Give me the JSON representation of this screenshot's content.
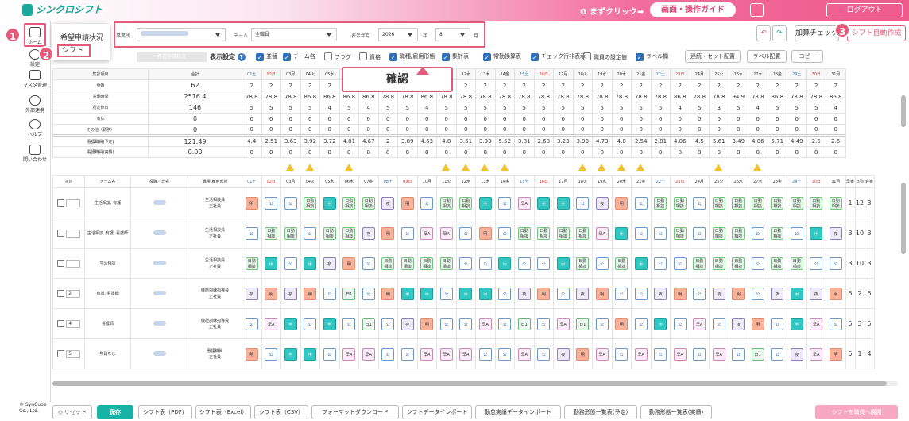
{
  "header": {
    "logo": "シンクロシフト",
    "prompt": "❶ まずクリック➡",
    "guide": "画面・操作ガイド",
    "logout": "ログアウト"
  },
  "sidebar": [
    {
      "label": "ホーム",
      "icon": "home-calendar-icon"
    },
    {
      "label": "設定",
      "icon": "gear-icon"
    },
    {
      "label": "マスタ管理",
      "icon": "database-icon"
    },
    {
      "label": "外部連携",
      "icon": "cloud-icon"
    },
    {
      "label": "ヘルプ",
      "icon": "help-icon"
    },
    {
      "label": "問い合わせ",
      "icon": "mail-icon"
    }
  ],
  "copyright": "© SynCube Co., Ltd.",
  "callouts": [
    "1",
    "2",
    "3"
  ],
  "popup": {
    "item1": "希望申請状況",
    "item2": "シフト"
  },
  "filters": {
    "office_label": "事業所",
    "team_label": "チーム",
    "team_value": "全職員",
    "ym_label": "表示年月",
    "year": "2026",
    "year_unit": "年",
    "month": "8",
    "month_unit": "月",
    "tab": "希望申請状況"
  },
  "toolbar": {
    "add_check": "加算チェック",
    "auto": "シフト自動作成"
  },
  "display": {
    "label": "表示設定",
    "options": [
      {
        "label": "並替",
        "on": true
      },
      {
        "label": "チーム名",
        "on": true
      },
      {
        "label": "フラグ",
        "on": false
      },
      {
        "label": "資格",
        "on": false
      },
      {
        "label": "職種/雇用形態",
        "on": true
      },
      {
        "label": "集計表",
        "on": true
      },
      {
        "label": "常勤換算表",
        "on": true
      },
      {
        "label": "チェック行非表示",
        "on": true
      },
      {
        "label": "職員の設定値",
        "on": false
      },
      {
        "label": "ラベル欄",
        "on": true
      }
    ],
    "buttons": [
      "連続・セット配置",
      "ラベル配置",
      "コピー"
    ]
  },
  "tooltip": "確認",
  "days": [
    "01土",
    "02日",
    "03月",
    "04火",
    "05水",
    "06木",
    "07金",
    "08土",
    "09日",
    "10月",
    "11火",
    "12水",
    "13木",
    "14金",
    "15土",
    "16日",
    "17月",
    "18火",
    "19水",
    "20木",
    "21金",
    "22土",
    "23日",
    "24月",
    "25火",
    "26水",
    "27木",
    "28金",
    "29土",
    "30日",
    "31月"
  ],
  "summary": {
    "headers": [
      "集計項目",
      "合計"
    ],
    "rows": [
      {
        "label": "明番",
        "total": "62",
        "vals": [
          "2",
          "2",
          "2",
          "2",
          "2",
          "2",
          "2",
          "2",
          "2",
          "2",
          "2",
          "2",
          "2",
          "2",
          "2",
          "2",
          "2",
          "2",
          "2",
          "2",
          "2",
          "2",
          "2",
          "2",
          "2",
          "2",
          "2",
          "2",
          "2",
          "2",
          "2"
        ]
      },
      {
        "label": "労働時間",
        "total": "2516.4",
        "vals": [
          "78.8",
          "78.8",
          "78.8",
          "86.8",
          "86.8",
          "86.8",
          "86.8",
          "78.8",
          "78.8",
          "86.8",
          "78.8",
          "78.8",
          "78.8",
          "78.8",
          "78.8",
          "78.8",
          "78.8",
          "78.8",
          "78.8",
          "78.8",
          "78.8",
          "78.8",
          "86.8",
          "78.8",
          "78.8",
          "94.9",
          "78.8",
          "86.8",
          "78.8",
          "78.8",
          "86.8"
        ]
      },
      {
        "label": "所定休日",
        "total": "146",
        "vals": [
          "5",
          "5",
          "5",
          "5",
          "4",
          "5",
          "4",
          "5",
          "5",
          "4",
          "5",
          "5",
          "5",
          "5",
          "5",
          "5",
          "5",
          "5",
          "5",
          "5",
          "5",
          "5",
          "4",
          "5",
          "3",
          "5",
          "4",
          "5",
          "5",
          "5",
          "4"
        ]
      },
      {
        "label": "有休",
        "total": "0",
        "vals": [
          "0",
          "0",
          "0",
          "0",
          "0",
          "0",
          "0",
          "0",
          "0",
          "0",
          "0",
          "0",
          "0",
          "0",
          "0",
          "0",
          "0",
          "0",
          "0",
          "0",
          "0",
          "0",
          "0",
          "0",
          "0",
          "0",
          "0",
          "0",
          "0",
          "0",
          "0"
        ]
      },
      {
        "label": "その他（勤務）",
        "total": "0",
        "vals": [
          "0",
          "0",
          "0",
          "0",
          "0",
          "0",
          "0",
          "0",
          "0",
          "0",
          "0",
          "0",
          "0",
          "0",
          "0",
          "0",
          "0",
          "0",
          "0",
          "0",
          "0",
          "0",
          "0",
          "0",
          "0",
          "0",
          "0",
          "0",
          "0",
          "0",
          "0"
        ]
      },
      {
        "label": "看護職員(予定)",
        "total": "121.49",
        "vals": [
          "4.4",
          "2.51",
          "3.63",
          "3.92",
          "3.72",
          "4.81",
          "4.67",
          "2",
          "3.89",
          "4.63",
          "4.8",
          "3.61",
          "3.93",
          "5.52",
          "3.81",
          "2.68",
          "3.23",
          "3.93",
          "4.73",
          "4.8",
          "2.54",
          "2.81",
          "4.06",
          "4.5",
          "5.61",
          "3.49",
          "4.06",
          "5.71",
          "4.49",
          "2.5",
          "2.5"
        ]
      },
      {
        "label": "看護職員(実績)",
        "total": "0.00",
        "vals": [
          "0",
          "0",
          "0",
          "0",
          "0",
          "0",
          "0",
          "0",
          "0",
          "0",
          "0",
          "0",
          "0",
          "0",
          "0",
          "0",
          "0",
          "0",
          "0",
          "0",
          "0",
          "0",
          "0",
          "0",
          "0",
          "0",
          "0",
          "0",
          "0",
          "0",
          "0"
        ]
      }
    ]
  },
  "warn_days": [
    3,
    4,
    6,
    11,
    12,
    13,
    14,
    18,
    19,
    20,
    21,
    25,
    27
  ],
  "staff": {
    "headers": [
      "並替",
      "チーム名",
      "役職／氏名",
      "職種/雇用形態"
    ],
    "tail_headers": [
      "早番",
      "日勤",
      "遅番"
    ],
    "rows": [
      {
        "order": "",
        "team": "生活相談, 有護",
        "job": "生活相談員\n正社員",
        "shifts": [
          "明",
          "公",
          "公",
          "日勤相談",
          "㊥",
          "日勤相談",
          "日勤相談",
          "夜",
          "明",
          "公",
          "日勤相談",
          "日勤相談",
          "㊥",
          "公",
          "早A",
          "㊥",
          "㊥",
          "公",
          "夜",
          "明",
          "公",
          "日勤相談",
          "日勤相談",
          "公",
          "日勤相談",
          "日勤相談",
          "日勤相談",
          "日勤相談",
          "日勤相談",
          "日勤相談",
          "日勤相談"
        ],
        "tail": [
          "1",
          "12",
          "3"
        ]
      },
      {
        "order": "",
        "team": "生活相談, 有護, 看護師",
        "job": "生活相談員\n正社員",
        "shifts": [
          "公",
          "日勤相談",
          "日勤相談",
          "公",
          "日勤相談",
          "日勤相談",
          "夜",
          "明",
          "公",
          "早A",
          "早A",
          "公",
          "明",
          "公",
          "日勤相談",
          "日勤相談",
          "日勤相談",
          "日勤相談",
          "早A",
          "㊥",
          "公",
          "公",
          "日勤相談",
          "公",
          "日勤相談",
          "日勤相談",
          "公",
          "日勤相談",
          "公",
          "㊥",
          "夜"
        ],
        "tail": [
          "3",
          "10",
          "3"
        ]
      },
      {
        "order": "",
        "team": "生活相談",
        "job": "生活相談員\n正社員",
        "shifts": [
          "日勤相談",
          "㊥",
          "公",
          "㊥",
          "夜",
          "明",
          "公",
          "日勤相談",
          "日勤相談",
          "日勤相談",
          "日勤相談",
          "公",
          "公",
          "㊥",
          "公",
          "公",
          "㊥",
          "日勤相談",
          "公",
          "日勤相談",
          "㊥",
          "公",
          "公",
          "日勤相談",
          "日勤相談",
          "日勤相談",
          "公",
          "日勤相談",
          "日勤相談",
          "公",
          "公"
        ],
        "tail": [
          "3",
          "10",
          "3"
        ]
      },
      {
        "order": "2",
        "team": "有護, 看護師",
        "job": "機能訓練指導員\n正社員",
        "shifts": [
          "夜",
          "明",
          "夜",
          "明",
          "公",
          "日1",
          "公",
          "明",
          "㊥",
          "㊥",
          "公",
          "㊥",
          "㊥",
          "公",
          "夜",
          "明",
          "公",
          "夜",
          "明",
          "公",
          "公",
          "夜",
          "明",
          "公",
          "夜",
          "明",
          "公",
          "夜",
          "㊥",
          "夜",
          "明"
        ],
        "tail": [
          "5",
          "2",
          "5"
        ]
      },
      {
        "order": "4",
        "team": "看護師",
        "job": "機能訓練指導員\n正社員",
        "shifts": [
          "公",
          "早A",
          "㊥",
          "公",
          "㊥",
          "公",
          "日1",
          "公",
          "夜",
          "明",
          "公",
          "公",
          "早A",
          "公",
          "日1",
          "公",
          "早A",
          "日1",
          "公",
          "明",
          "公",
          "㊥",
          "公",
          "早A",
          "公",
          "夜",
          "明",
          "公",
          "㊥",
          "早A",
          "公"
        ],
        "tail": [
          "5",
          "3",
          "5"
        ]
      },
      {
        "order": "5",
        "team": "所属なし",
        "job": "看護職員\n正社員",
        "shifts": [
          "明",
          "公",
          "㊥",
          "㊥",
          "公",
          "早A",
          "早A",
          "公",
          "公",
          "早A",
          "早A",
          "早A",
          "公",
          "公",
          "早A",
          "公",
          "夜",
          "明",
          "早A",
          "公",
          "早A",
          "公",
          "早A",
          "公",
          "早A",
          "公",
          "日1",
          "公",
          "夜",
          "早A",
          "明"
        ],
        "tail": [
          "5",
          "1",
          "4"
        ]
      }
    ]
  },
  "bottom": {
    "reset": "◇ リセット",
    "save": "保存",
    "buttons": [
      "シフト表（PDF）",
      "シフト表（Excel）",
      "シフト表（CSV）",
      "フォーマットダウンロード",
      "シフトデータインポート",
      "勤怠実績データインポート",
      "勤務形態一覧表(予定)",
      "勤務形態一覧表(実績)"
    ],
    "apply": "シフトを職員へ展開"
  }
}
